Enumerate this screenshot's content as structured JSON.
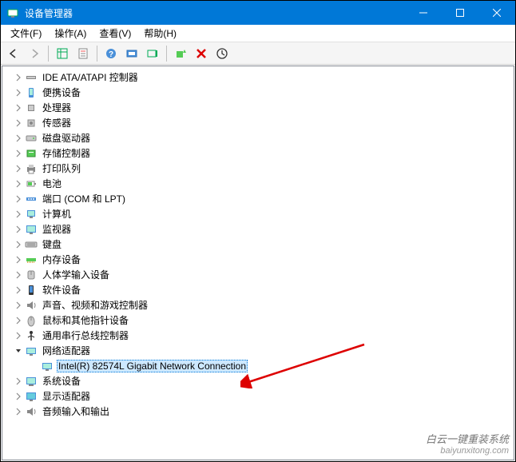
{
  "window": {
    "title": "设备管理器"
  },
  "menubar": {
    "items": [
      {
        "label": "文件(F)"
      },
      {
        "label": "操作(A)"
      },
      {
        "label": "查看(V)"
      },
      {
        "label": "帮助(H)"
      }
    ]
  },
  "tree": {
    "items": [
      {
        "indent": 1,
        "arrow": "right",
        "icon": "ide",
        "label": "IDE ATA/ATAPI 控制器",
        "selected": false
      },
      {
        "indent": 1,
        "arrow": "right",
        "icon": "portable",
        "label": "便携设备",
        "selected": false
      },
      {
        "indent": 1,
        "arrow": "right",
        "icon": "cpu",
        "label": "处理器",
        "selected": false
      },
      {
        "indent": 1,
        "arrow": "right",
        "icon": "sensor",
        "label": "传感器",
        "selected": false
      },
      {
        "indent": 1,
        "arrow": "right",
        "icon": "disk",
        "label": "磁盘驱动器",
        "selected": false
      },
      {
        "indent": 1,
        "arrow": "right",
        "icon": "storage",
        "label": "存储控制器",
        "selected": false
      },
      {
        "indent": 1,
        "arrow": "right",
        "icon": "printer",
        "label": "打印队列",
        "selected": false
      },
      {
        "indent": 1,
        "arrow": "right",
        "icon": "battery",
        "label": "电池",
        "selected": false
      },
      {
        "indent": 1,
        "arrow": "right",
        "icon": "port",
        "label": "端口 (COM 和 LPT)",
        "selected": false
      },
      {
        "indent": 1,
        "arrow": "right",
        "icon": "computer",
        "label": "计算机",
        "selected": false
      },
      {
        "indent": 1,
        "arrow": "right",
        "icon": "monitor",
        "label": "监视器",
        "selected": false
      },
      {
        "indent": 1,
        "arrow": "right",
        "icon": "keyboard",
        "label": "键盘",
        "selected": false
      },
      {
        "indent": 1,
        "arrow": "right",
        "icon": "memory",
        "label": "内存设备",
        "selected": false
      },
      {
        "indent": 1,
        "arrow": "right",
        "icon": "hid",
        "label": "人体学输入设备",
        "selected": false
      },
      {
        "indent": 1,
        "arrow": "right",
        "icon": "software",
        "label": "软件设备",
        "selected": false
      },
      {
        "indent": 1,
        "arrow": "right",
        "icon": "sound",
        "label": "声音、视频和游戏控制器",
        "selected": false
      },
      {
        "indent": 1,
        "arrow": "right",
        "icon": "mouse",
        "label": "鼠标和其他指针设备",
        "selected": false
      },
      {
        "indent": 1,
        "arrow": "right",
        "icon": "usb",
        "label": "通用串行总线控制器",
        "selected": false
      },
      {
        "indent": 1,
        "arrow": "down",
        "icon": "network",
        "label": "网络适配器",
        "selected": false
      },
      {
        "indent": 2,
        "arrow": "none",
        "icon": "network",
        "label": "Intel(R) 82574L Gigabit Network Connection",
        "selected": true
      },
      {
        "indent": 1,
        "arrow": "right",
        "icon": "system",
        "label": "系统设备",
        "selected": false
      },
      {
        "indent": 1,
        "arrow": "right",
        "icon": "display",
        "label": "显示适配器",
        "selected": false
      },
      {
        "indent": 1,
        "arrow": "right",
        "icon": "audio",
        "label": "音频输入和输出",
        "selected": false
      }
    ]
  },
  "watermark": {
    "line1": "白云一键重装系统",
    "line2": "baiyunxitong.com"
  }
}
